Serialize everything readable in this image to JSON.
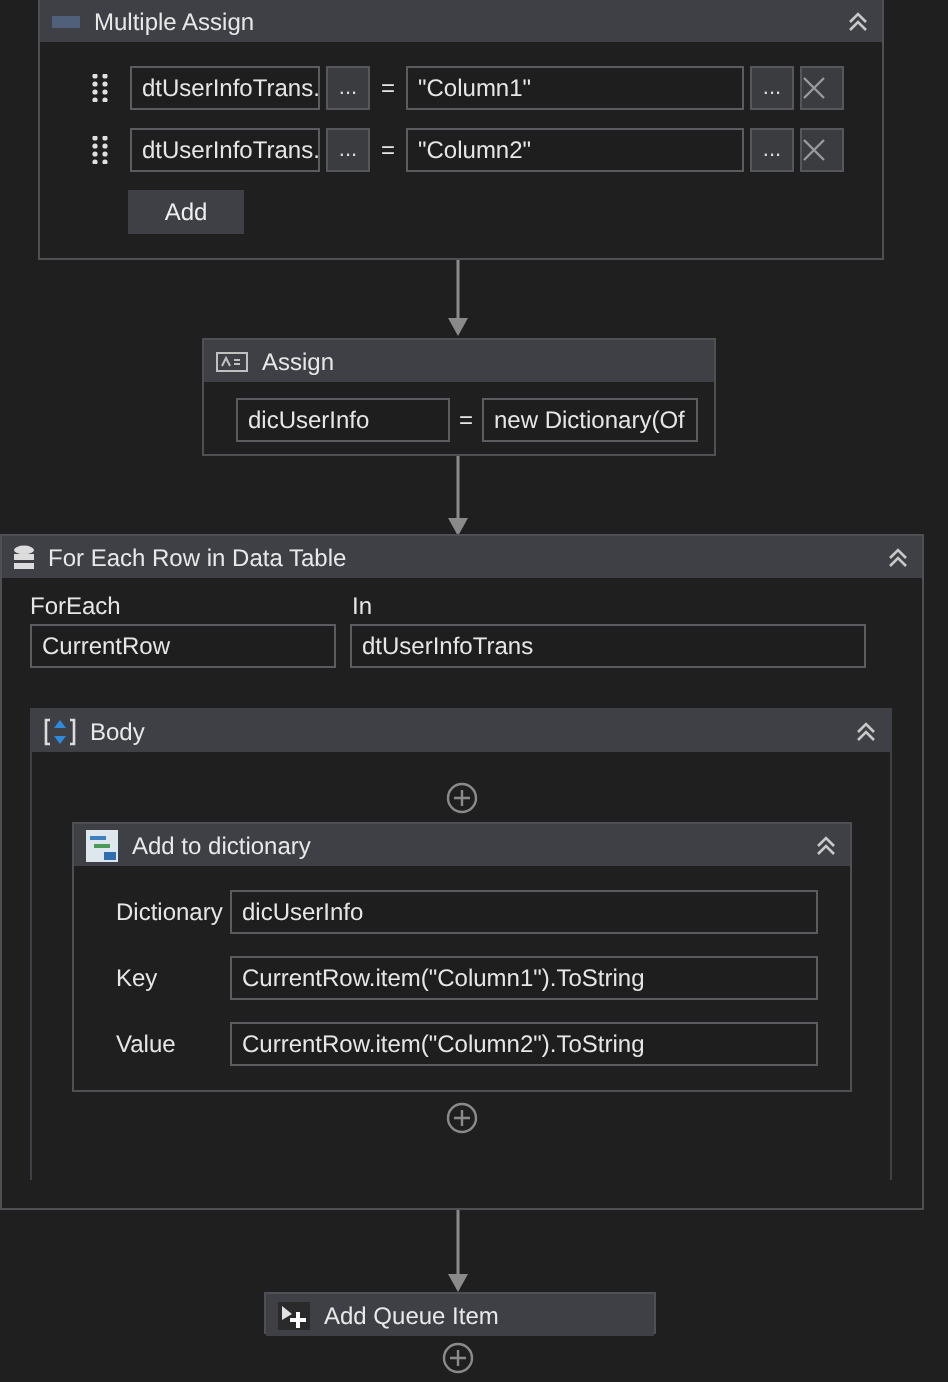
{
  "multiple_assign": {
    "title": "Multiple Assign",
    "rows": [
      {
        "target": "dtUserInfoTrans.",
        "target_button": "...",
        "operator": "=",
        "value": "\"Column1\"",
        "value_button": "..."
      },
      {
        "target": "dtUserInfoTrans.",
        "target_button": "...",
        "operator": "=",
        "value": "\"Column2\"",
        "value_button": "..."
      }
    ],
    "add_button": "Add"
  },
  "assign": {
    "title": "Assign",
    "target": "dicUserInfo",
    "operator": "=",
    "value": "new Dictionary(Of"
  },
  "for_each": {
    "title": "For Each Row in Data Table",
    "foreach_label": "ForEach",
    "foreach_value": "CurrentRow",
    "in_label": "In",
    "in_value": "dtUserInfoTrans",
    "body": {
      "title": "Body",
      "activity": {
        "title": "Add to dictionary",
        "fields": [
          {
            "label": "Dictionary",
            "value": "dicUserInfo"
          },
          {
            "label": "Key",
            "value": "CurrentRow.item(\"Column1\").ToString"
          },
          {
            "label": "Value",
            "value": "CurrentRow.item(\"Column2\").ToString"
          }
        ]
      }
    }
  },
  "queue_item": {
    "title": "Add Queue Item"
  }
}
